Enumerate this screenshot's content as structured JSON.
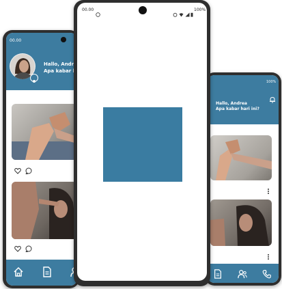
{
  "center_phone": {
    "status_time": "00.00",
    "status_battery": "100%",
    "placeholder_color": "#3a7ca1"
  },
  "left_phone": {
    "status_time": "00.00",
    "greeting_line1": "Hallo, Andrea",
    "greeting_line2": "Apa kabar hari ini?",
    "nav_items": [
      "home-icon",
      "document-icon",
      "people-icon"
    ]
  },
  "right_phone": {
    "status_battery": "100%",
    "greeting_line1": "Hallo, Andrea",
    "greeting_line2": "Apa kabar hari ini?",
    "nav_items": [
      "document-icon",
      "people-icon",
      "phone-icon"
    ]
  },
  "colors": {
    "brand": "#3d7ca0",
    "frame": "#2e2e2e"
  }
}
